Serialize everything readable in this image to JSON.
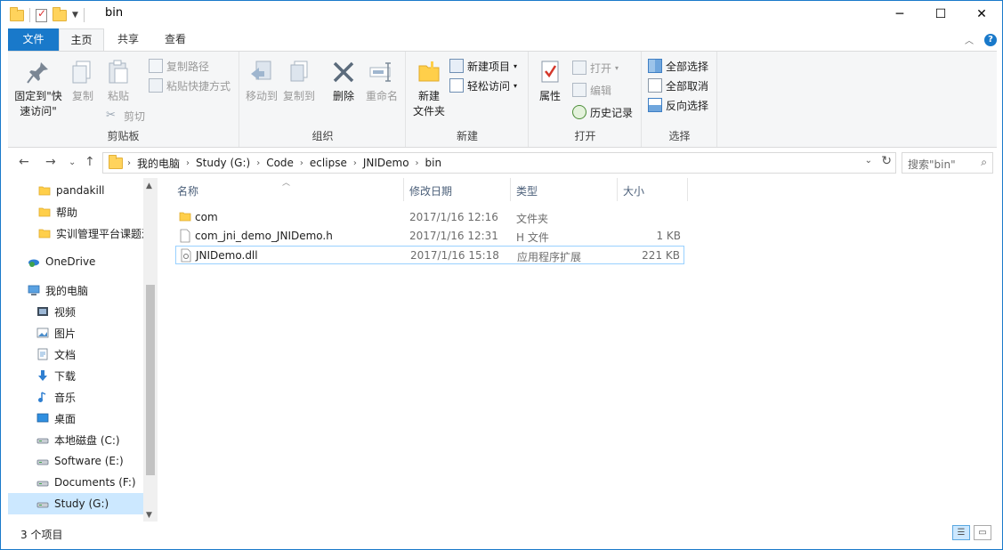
{
  "window": {
    "title": "bin",
    "minimize": "─",
    "maximize": "☐",
    "close": "✕"
  },
  "tabs": {
    "file": "文件",
    "home": "主页",
    "share": "共享",
    "view": "查看"
  },
  "ribbon": {
    "clipboard": {
      "label": "剪贴板",
      "pin": "固定到\"快速访问\"",
      "pin_l1": "固定到\"快",
      "pin_l2": "速访问\"",
      "copy": "复制",
      "paste": "粘贴",
      "copy_path": "复制路径",
      "paste_shortcut": "粘贴快捷方式",
      "cut": "剪切"
    },
    "organize": {
      "label": "组织",
      "move_to": "移动到",
      "copy_to": "复制到",
      "delete": "删除",
      "rename": "重命名"
    },
    "new": {
      "label": "新建",
      "new_folder_l1": "新建",
      "new_folder_l2": "文件夹",
      "new_item": "新建项目",
      "easy_access": "轻松访问"
    },
    "open": {
      "label": "打开",
      "properties": "属性",
      "open": "打开",
      "edit": "编辑",
      "history": "历史记录"
    },
    "select": {
      "label": "选择",
      "select_all": "全部选择",
      "select_none": "全部取消",
      "invert": "反向选择"
    }
  },
  "address": {
    "crumbs": [
      "我的电脑",
      "Study (G:)",
      "Code",
      "eclipse",
      "JNIDemo",
      "bin"
    ],
    "search_placeholder": "搜索\"bin\""
  },
  "nav_pane": {
    "items": [
      {
        "label": "pandakill",
        "icon": "folder-icon"
      },
      {
        "label": "帮助",
        "icon": "folder-icon"
      },
      {
        "label": "实训管理平台课题汇",
        "icon": "folder-icon"
      },
      {
        "label": "OneDrive",
        "icon": "onedrive-icon"
      },
      {
        "label": "我的电脑",
        "icon": "computer-icon"
      },
      {
        "label": "视频",
        "icon": "video-icon"
      },
      {
        "label": "图片",
        "icon": "pictures-icon"
      },
      {
        "label": "文档",
        "icon": "documents-icon"
      },
      {
        "label": "下载",
        "icon": "download-icon"
      },
      {
        "label": "音乐",
        "icon": "music-icon"
      },
      {
        "label": "桌面",
        "icon": "desktop-icon"
      },
      {
        "label": "本地磁盘 (C:)",
        "icon": "drive-icon"
      },
      {
        "label": "Software (E:)",
        "icon": "drive-icon"
      },
      {
        "label": "Documents (F:)",
        "icon": "drive-icon"
      },
      {
        "label": "Study (G:)",
        "icon": "drive-icon"
      }
    ]
  },
  "file_list": {
    "columns": {
      "name": "名称",
      "date": "修改日期",
      "type": "类型",
      "size": "大小"
    },
    "rows": [
      {
        "name": "com",
        "date": "2017/1/16 12:16",
        "type": "文件夹",
        "size": "",
        "icon": "folder-icon"
      },
      {
        "name": "com_jni_demo_JNIDemo.h",
        "date": "2017/1/16 12:31",
        "type": "H 文件",
        "size": "1 KB",
        "icon": "file-icon"
      },
      {
        "name": "JNIDemo.dll",
        "date": "2017/1/16 15:18",
        "type": "应用程序扩展",
        "size": "221 KB",
        "icon": "dll-icon"
      }
    ]
  },
  "status": {
    "count": "3 个项目"
  },
  "colors": {
    "accent": "#1979ca",
    "selection": "#cce8ff",
    "header_text": "#4c607a"
  }
}
